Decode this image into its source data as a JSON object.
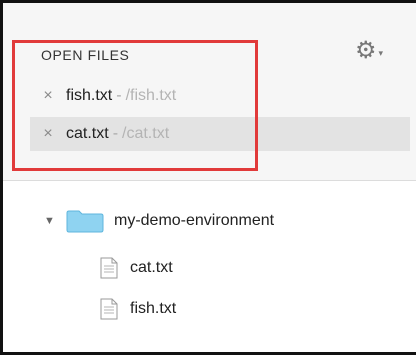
{
  "open_files": {
    "title": "OPEN FILES",
    "files": [
      {
        "name": "fish.txt",
        "separator": "-",
        "path": "/fish.txt",
        "active": false
      },
      {
        "name": "cat.txt",
        "separator": "-",
        "path": "/cat.txt",
        "active": true
      }
    ],
    "close_glyph": "×"
  },
  "settings": {
    "icon": "gear-icon",
    "caret_glyph": "▾",
    "gear_glyph": "⚙"
  },
  "tree": {
    "folder": {
      "name": "my-demo-environment",
      "expanded": true,
      "expand_glyph": "▼"
    },
    "files": [
      {
        "name": "cat.txt"
      },
      {
        "name": "fish.txt"
      }
    ]
  },
  "colors": {
    "highlight_border": "#e13a3a",
    "folder": "#8fd3f1",
    "active_row": "#e3e3e3"
  }
}
